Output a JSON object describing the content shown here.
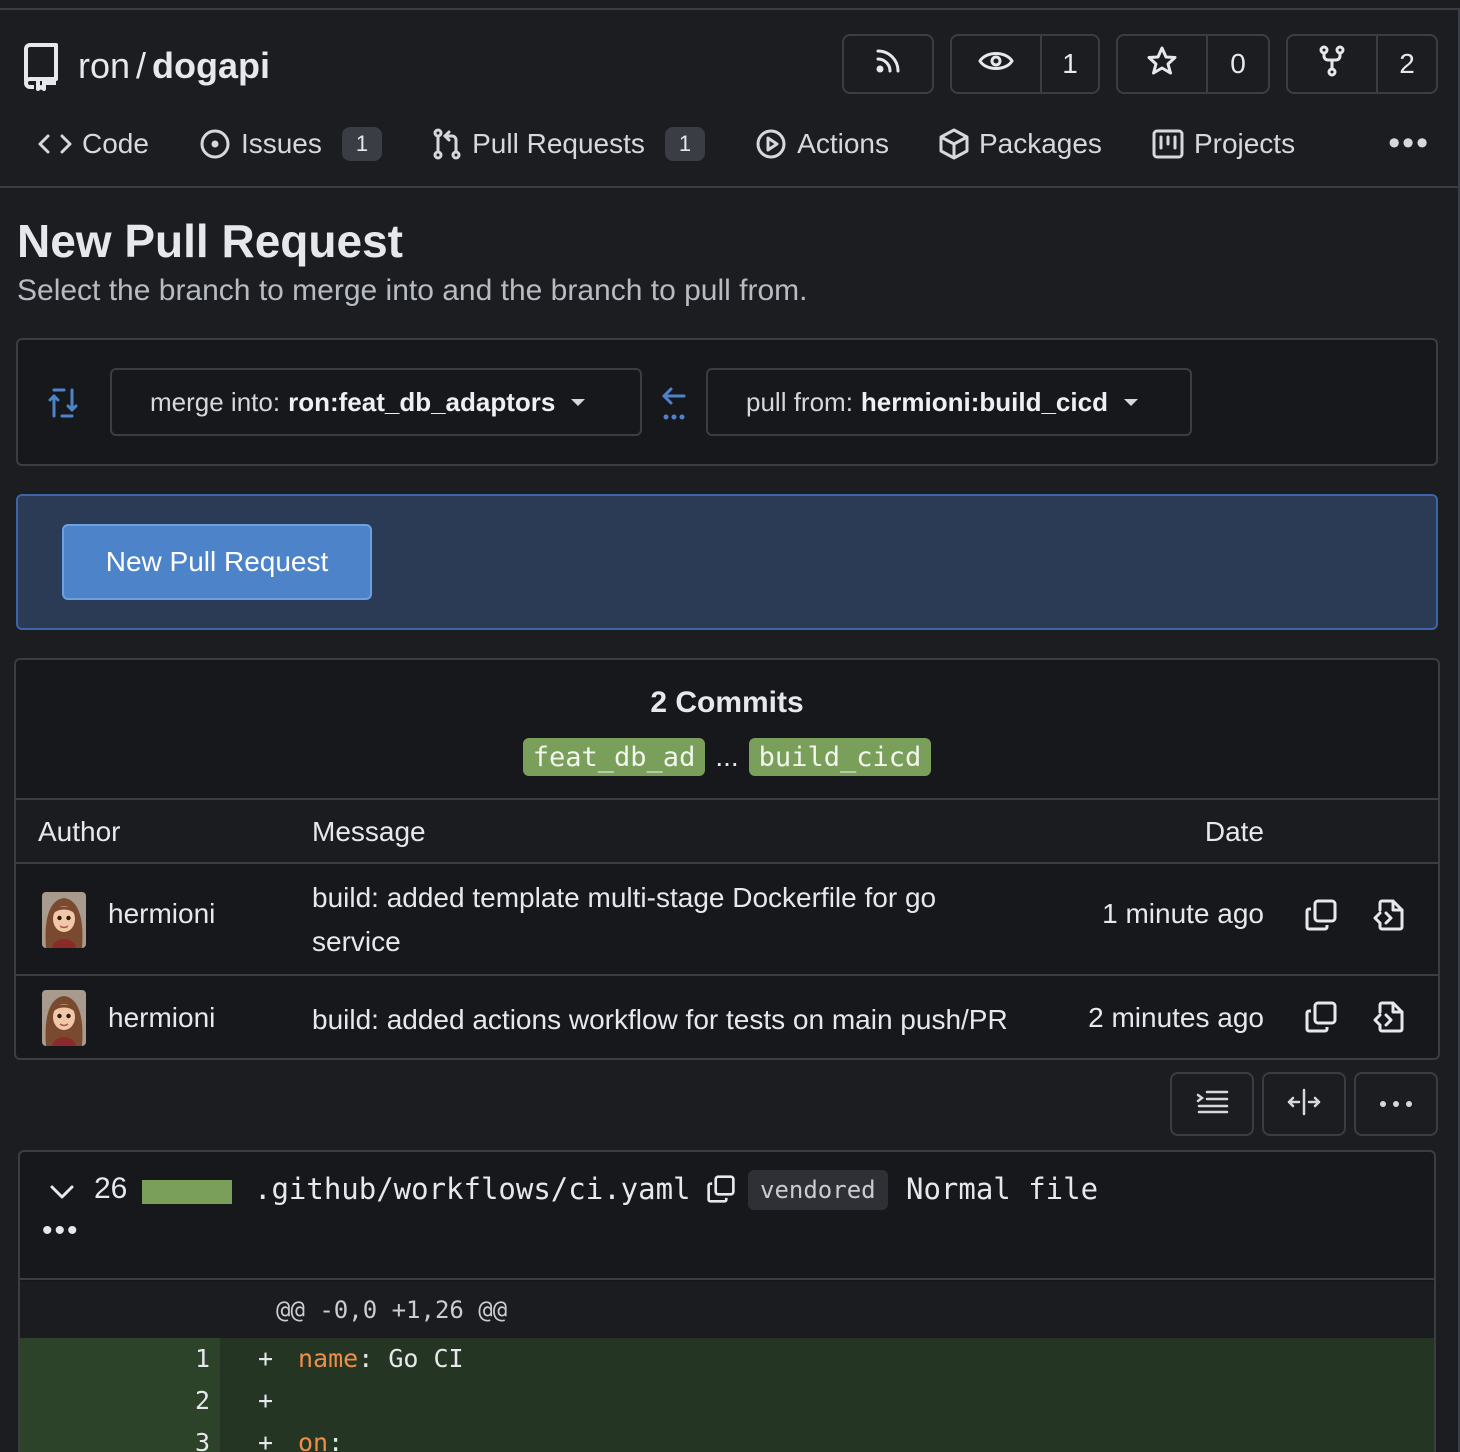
{
  "repo": {
    "owner": "ron",
    "separator": "/",
    "name": "dogapi"
  },
  "header_buttons": {
    "rss_icon": "rss-icon",
    "watch_count": "1",
    "star_count": "0",
    "fork_count": "2"
  },
  "tabs": [
    {
      "label": "Code",
      "icon": "code-icon"
    },
    {
      "label": "Issues",
      "icon": "issue-icon",
      "count": "1"
    },
    {
      "label": "Pull Requests",
      "icon": "pull-request-icon",
      "count": "1"
    },
    {
      "label": "Actions",
      "icon": "play-icon"
    },
    {
      "label": "Packages",
      "icon": "package-icon"
    },
    {
      "label": "Projects",
      "icon": "project-icon"
    }
  ],
  "more_label": "•••",
  "page": {
    "title": "New Pull Request",
    "subtitle": "Select the branch to merge into and the branch to pull from."
  },
  "branches": {
    "merge_prefix": "merge into:",
    "merge_value": "ron:feat_db_adaptors",
    "pull_prefix": "pull from:",
    "pull_value": "hermioni:build_cicd"
  },
  "new_pr_button": "New Pull Request",
  "commits": {
    "title": "2 Commits",
    "base_ref": "feat_db_ad",
    "ref_separator": "...",
    "head_ref": "build_cicd",
    "headers": {
      "author": "Author",
      "message": "Message",
      "date": "Date"
    },
    "rows": [
      {
        "author": "hermioni",
        "message": "build: added template multi-stage Dockerfile for go service",
        "date": "1 minute ago"
      },
      {
        "author": "hermioni",
        "message": "build: added actions workflow for tests on main push/PR",
        "date": "2 minutes ago"
      }
    ]
  },
  "file": {
    "changes": "26",
    "path": ".github/workflows/ci.yaml",
    "badge": "vendored",
    "type": "Normal file",
    "more": "•••",
    "hunk_header": "@@ -0,0 +1,26 @@",
    "lines": [
      {
        "num": "1",
        "sign": "+",
        "key": "name",
        "rest": ": Go CI"
      },
      {
        "num": "2",
        "sign": "+",
        "key": "",
        "rest": ""
      },
      {
        "num": "3",
        "sign": "+",
        "key": "on",
        "rest": ":"
      }
    ]
  },
  "colors": {
    "accent_blue": "#4d84c9",
    "ref_green": "#7a9f5a",
    "diff_add_bg": "#253524",
    "yaml_key": "#f08d49"
  }
}
